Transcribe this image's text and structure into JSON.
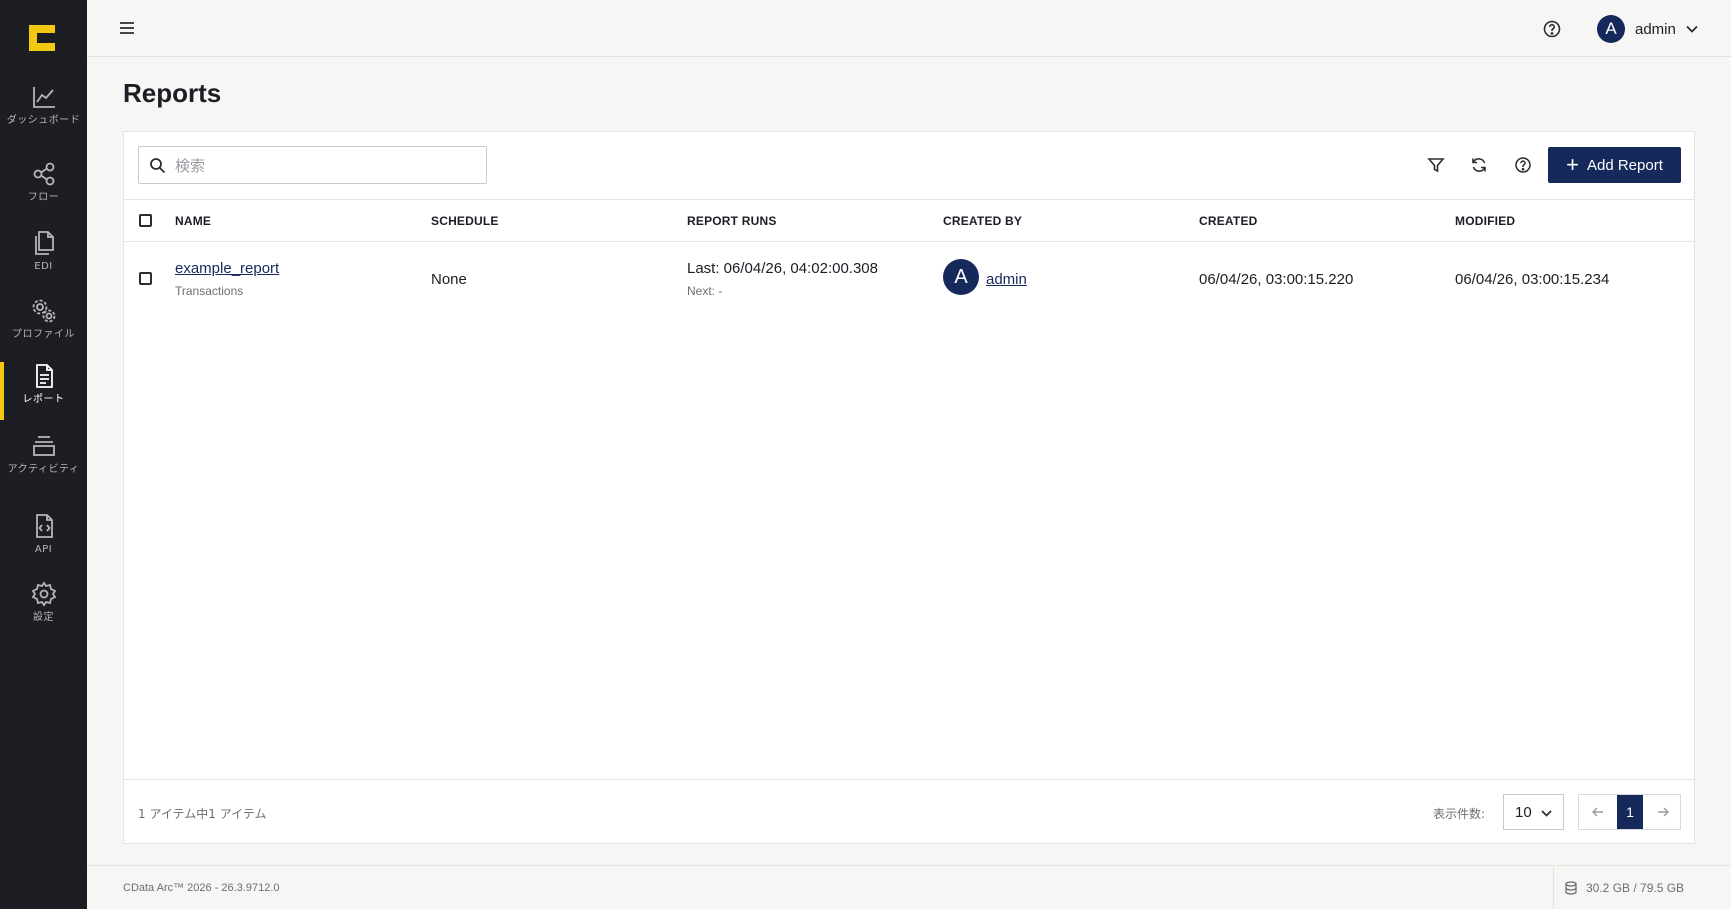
{
  "sidebar": {
    "logo": "CData logo",
    "accent": "#f2c811",
    "items": [
      {
        "label": "ダッシュボード",
        "icon": "chart-line-icon"
      },
      {
        "label": "フロー",
        "icon": "share-nodes-icon"
      },
      {
        "label": "EDI",
        "icon": "documents-icon"
      },
      {
        "label": "プロファイル",
        "icon": "gears-icon"
      },
      {
        "label": "レポート",
        "icon": "report-file-icon",
        "active": true
      },
      {
        "label": "アクティビティ",
        "icon": "stack-icon"
      },
      {
        "label": "API",
        "icon": "api-file-icon"
      },
      {
        "label": "設定",
        "icon": "gear-icon"
      }
    ]
  },
  "topbar": {
    "user": {
      "initial": "A",
      "name": "admin"
    }
  },
  "page": {
    "title": "Reports"
  },
  "toolbar": {
    "search_placeholder": "検索",
    "add_label": "Add Report"
  },
  "table": {
    "headers": {
      "name": "NAME",
      "schedule": "SCHEDULE",
      "runs": "REPORT RUNS",
      "created_by": "CREATED BY",
      "created": "CREATED",
      "modified": "MODIFIED"
    },
    "rows": [
      {
        "name": "example_report",
        "type": "Transactions",
        "schedule": "None",
        "last_run": "Last: 06/04/26, 04:02:00.308",
        "next_run": "Next: -",
        "creator_initial": "A",
        "creator": "admin",
        "created": "06/04/26, 03:00:15.220",
        "modified": "06/04/26, 03:00:15.234"
      }
    ]
  },
  "footer": {
    "count_text": "1 アイテム中1 アイテム",
    "per_page_label": "表示件数:",
    "per_page_value": "10",
    "current_page": "1"
  },
  "statusbar": {
    "version": "CData Arc™ 2026 - 26.3.9712.0",
    "storage": "30.2 GB / 79.5 GB"
  },
  "colors": {
    "primary": "#152a5b",
    "sidebar_bg": "#1c1e23"
  }
}
